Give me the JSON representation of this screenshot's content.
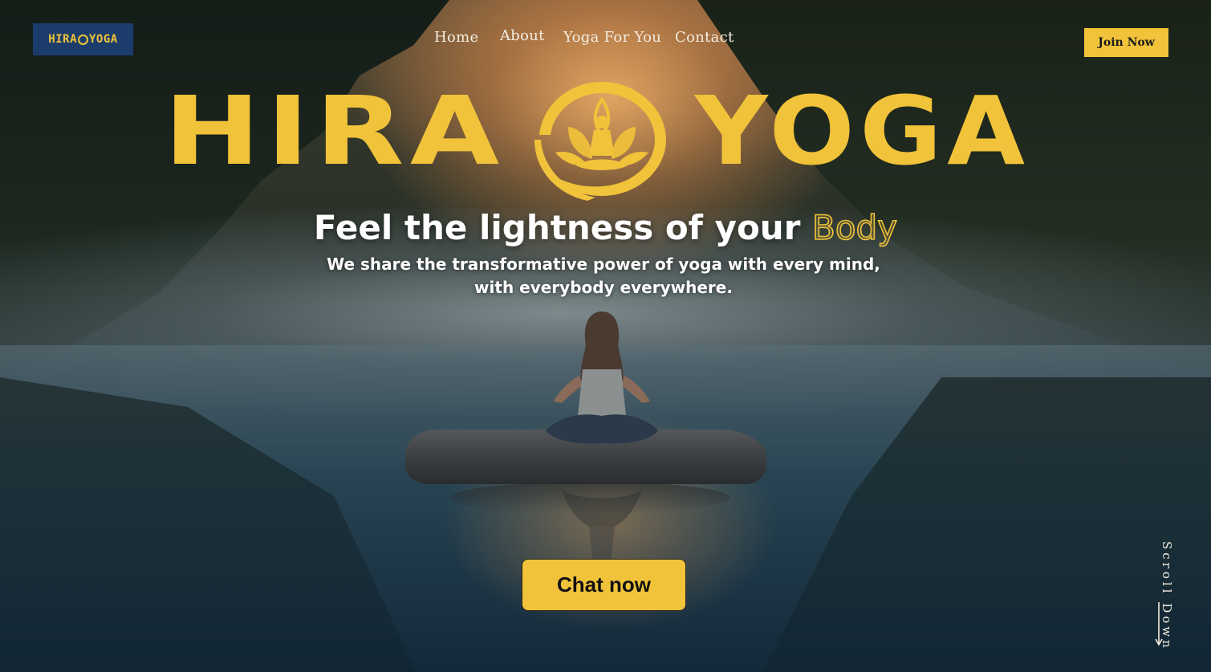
{
  "brand": {
    "logo_text_left": "HIRA",
    "logo_text_right": "YOGA",
    "accent_color": "#f1c33a",
    "logo_badge_color": "#1c3d6b"
  },
  "nav": {
    "items": [
      {
        "label": "Home"
      },
      {
        "label": "About"
      },
      {
        "label": "Yoga For You"
      },
      {
        "label": "Contact"
      }
    ],
    "join_label": "Join Now"
  },
  "hero": {
    "tagline_main": "Feel the lightness of your ",
    "tagline_highlight": "Body",
    "subtitle": "We share the transformative power of yoga with every mind, with everybody everywhere.",
    "cta_label": "Chat now"
  },
  "scroll": {
    "label": "Scroll Down",
    "icon": "arrow-down-icon"
  }
}
